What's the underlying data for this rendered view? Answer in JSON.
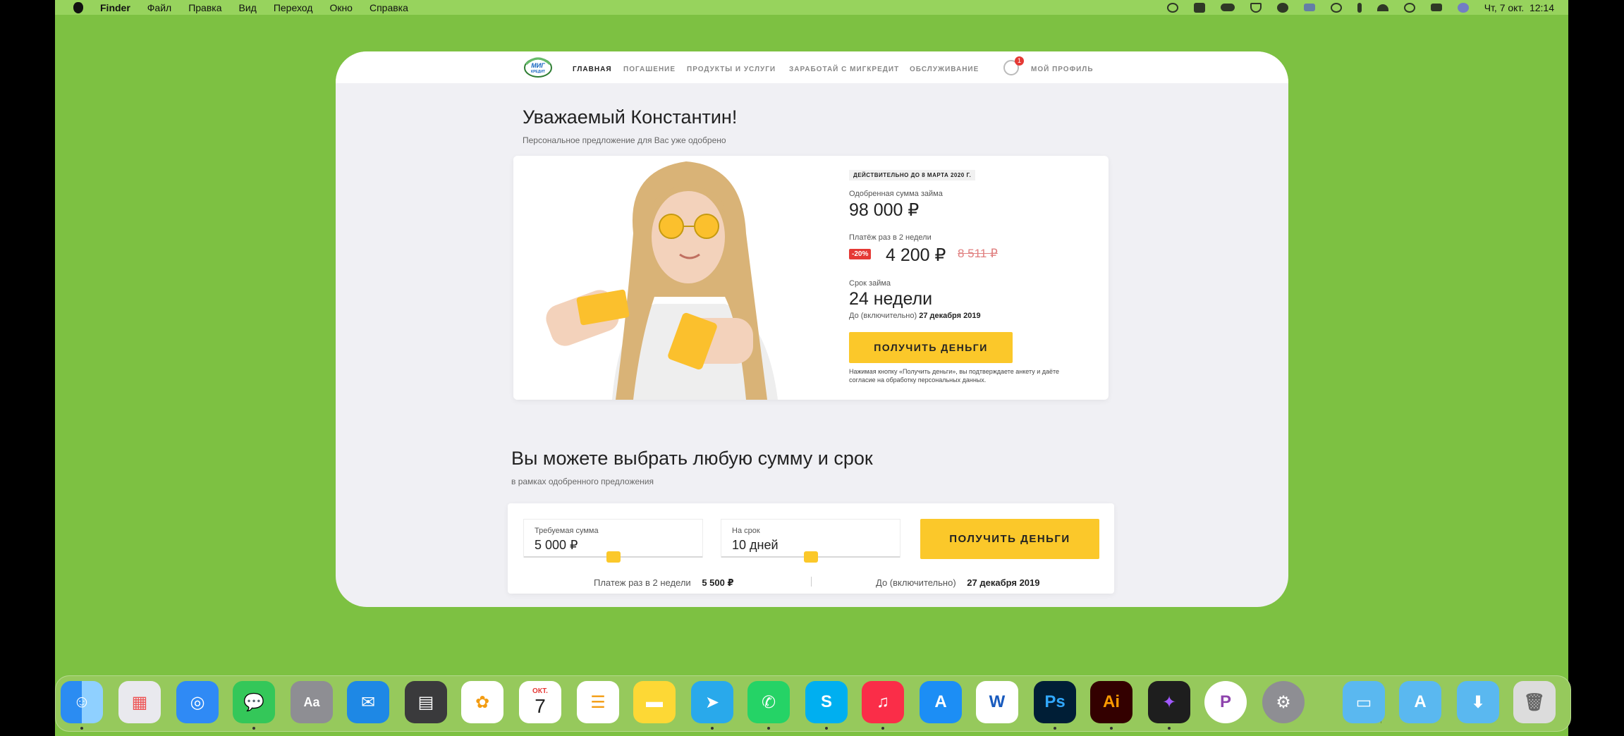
{
  "menubar": {
    "app": "Finder",
    "items": [
      "Файл",
      "Правка",
      "Вид",
      "Переход",
      "Окно",
      "Справка"
    ],
    "datetime": "Чт, 7 окт.  12:14"
  },
  "site": {
    "logo_text": "МИГ КРЕДИТ",
    "nav": [
      "ГЛАВНАЯ",
      "ПОГАШЕНИЕ",
      "ПРОДУКТЫ И УСЛУГИ",
      "ЗАРАБОТАЙ С МИГКРЕДИТ",
      "ОБСЛУЖИВАНИЕ"
    ],
    "profile_label": "МОЙ ПРОФИЛЬ",
    "profile_badge": "1"
  },
  "offer": {
    "greeting": "Уважаемый Константин!",
    "subtitle": "Персональное предложение для Вас уже одобрено",
    "valid_until": "ДЕЙСТВИТЕЛЬНО ДО 8 МАРТА 2020 Г.",
    "amount_label": "Одобренная сумма займа",
    "amount": "98 000 ₽",
    "payment_label": "Платёж раз в 2 недели",
    "discount": "-20%",
    "payment": "4 200 ₽",
    "old_payment": "8 511 ₽",
    "term_label": "Срок займа",
    "term": "24 недели",
    "until_label": "До (включительно)",
    "until_date": "27 декабря 2019",
    "button": "ПОЛУЧИТЬ ДЕНЬГИ",
    "note": "Нажимая кнопку «Получить деньги», вы подтверждаете анкету и даёте согласие на обработку персональных данных."
  },
  "calculator": {
    "title": "Вы можете выбрать любую сумму и срок",
    "subtitle": "в рамках одобренного предложения",
    "amount_label": "Требуемая сумма",
    "amount_value": "5 000 ₽",
    "term_label": "На срок",
    "term_value": "10 дней",
    "button": "ПОЛУЧИТЬ ДЕНЬГИ",
    "payment_label": "Платеж раз в 2 недели",
    "payment_value": "5 500 ₽",
    "until_label": "До (включительно)",
    "until_value": "27 декабря 2019"
  },
  "dock": {
    "calendar_month": "ОКТ.",
    "calendar_day": "7"
  }
}
